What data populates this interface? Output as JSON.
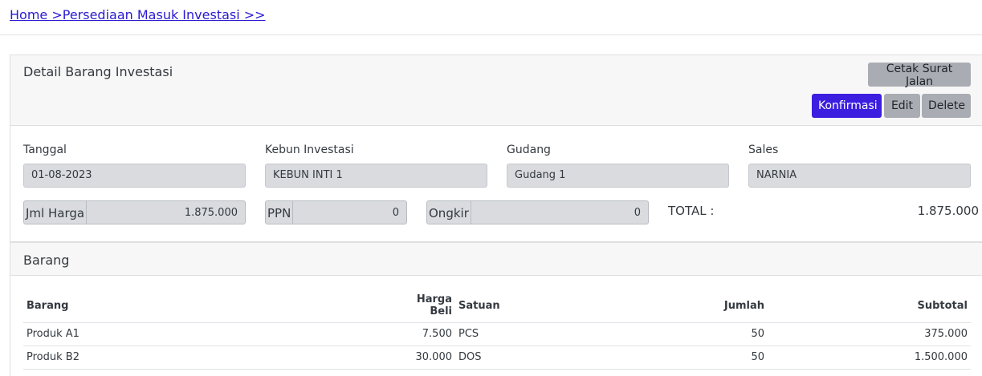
{
  "breadcrumb": {
    "home": "Home >",
    "section": "Persediaan Masuk Investasi >>"
  },
  "detail": {
    "title": "Detail Barang Investasi",
    "buttons": {
      "cetak": "Cetak Surat Jalan",
      "konfirmasi": "Konfirmasi",
      "edit": "Edit",
      "delete": "Delete"
    },
    "fields": {
      "tanggal": {
        "label": "Tanggal",
        "value": "01-08-2023"
      },
      "kebun": {
        "label": "Kebun Investasi",
        "value": "KEBUN INTI 1"
      },
      "gudang": {
        "label": "Gudang",
        "value": "Gudang 1"
      },
      "sales": {
        "label": "Sales",
        "value": "NARNIA"
      }
    },
    "jml_harga": {
      "label": "Jml Harga",
      "value": "1.875.000"
    },
    "ppn": {
      "label": "PPN",
      "value": "0"
    },
    "ongkir": {
      "label": "Ongkir",
      "value": "0"
    },
    "total": {
      "label": "TOTAL :",
      "value": "1.875.000"
    }
  },
  "barang": {
    "title": "Barang",
    "columns": [
      "Barang",
      "Harga Beli",
      "Satuan",
      "Jumlah",
      "Subtotal"
    ],
    "rows": [
      [
        "Produk A1",
        "7.500",
        "PCS",
        "50",
        "375.000"
      ],
      [
        "Produk B2",
        "30.000",
        "DOS",
        "50",
        "1.500.000"
      ]
    ]
  },
  "colors": {
    "primary": "#3b1ee0",
    "secondary": "#a9adb3",
    "link": "#2a1bd1"
  }
}
